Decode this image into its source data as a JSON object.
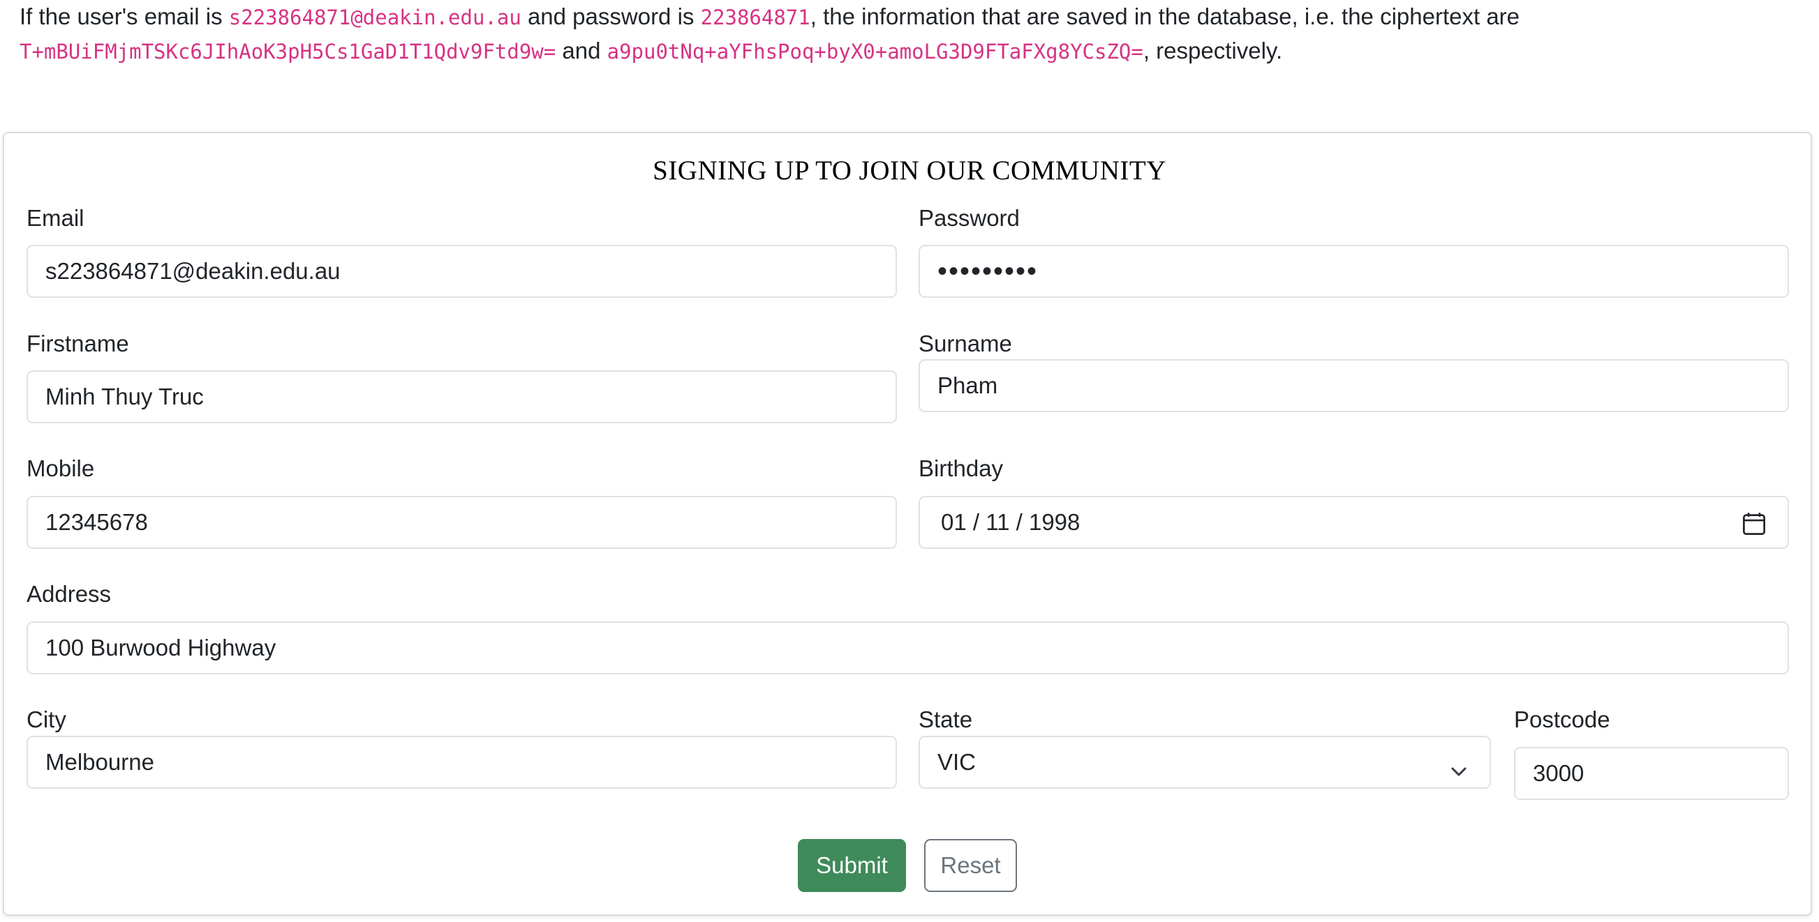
{
  "intro": {
    "t1": "If the user's email is ",
    "email_code": "s223864871@deakin.edu.au",
    "t2": " and password is ",
    "password_code": "223864871",
    "t3": ", the information that are saved in the database, i.e. the ciphertext are ",
    "cipher_email": "T+mBUiFMjmTSKc6JIhAoK3pH5Cs1GaD1T1Qdv9Ftd9w=",
    "t4": " and ",
    "cipher_password": "a9pu0tNq+aYFhsPoq+byX0+amoLG3D9FTaFXg8YCsZQ=",
    "t5": ", respectively."
  },
  "form": {
    "title": "SIGNING UP TO JOIN OUR COMMUNITY",
    "email": {
      "label": "Email",
      "value": "s223864871@deakin.edu.au"
    },
    "password": {
      "label": "Password",
      "value": "•••••••••"
    },
    "firstname": {
      "label": "Firstname",
      "value": "Minh Thuy Truc"
    },
    "surname": {
      "label": "Surname",
      "value": "Pham"
    },
    "mobile": {
      "label": "Mobile",
      "value": "12345678"
    },
    "birthday": {
      "label": "Birthday",
      "value": "01 / 11 / 1998",
      "icon": "calendar-icon"
    },
    "address": {
      "label": "Address",
      "value": "100 Burwood Highway"
    },
    "city": {
      "label": "City",
      "value": "Melbourne"
    },
    "state": {
      "label": "State",
      "value": "VIC",
      "icon": "chevron-down-icon"
    },
    "postcode": {
      "label": "Postcode",
      "value": "3000"
    },
    "submit_label": "Submit",
    "reset_label": "Reset"
  },
  "colors": {
    "code": "#d63384",
    "submit_bg": "#3f8a5a",
    "reset_border": "#6c757d",
    "field_border": "#dee2e6"
  }
}
